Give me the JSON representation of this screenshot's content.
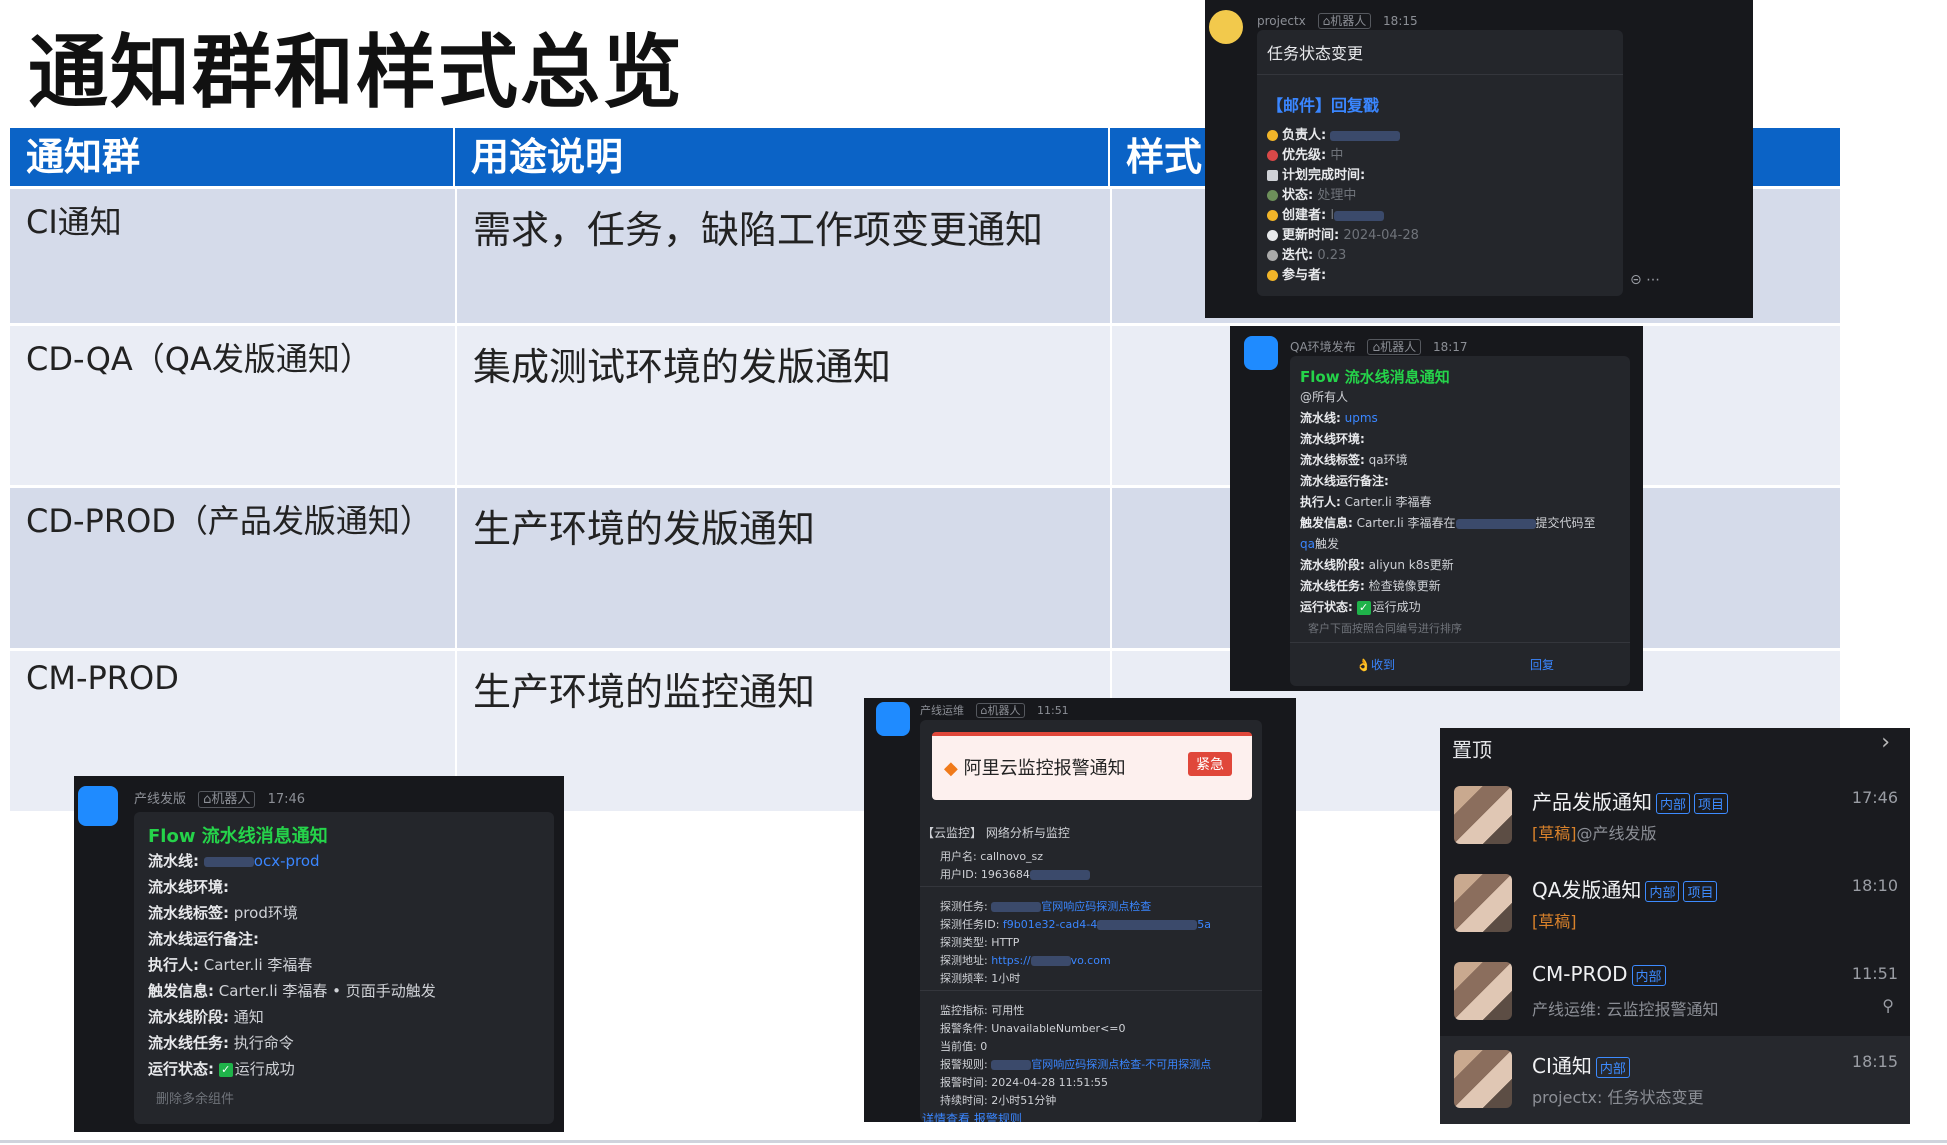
{
  "title": "通知群和样式总览",
  "table": {
    "headers": [
      "通知群",
      "用途说明",
      "样式"
    ],
    "rows": [
      {
        "group": "CI通知",
        "purpose": "需求，任务，缺陷工作项变更通知"
      },
      {
        "group": "CD-QA（QA发版通知）",
        "purpose": "集成测试环境的发版通知"
      },
      {
        "group": "CD-PROD（产品发版通知）",
        "purpose": "生产环境的发版通知"
      },
      {
        "group": "CM-PROD",
        "purpose": "生产环境的监控通知"
      }
    ]
  },
  "card_ci": {
    "sender": "projectx",
    "robot": "机器人",
    "time": "18:15",
    "header": "任务状态变更",
    "title": "【邮件】回复戳",
    "fields": [
      {
        "label": "负责人:",
        "value": ""
      },
      {
        "label": "优先级:",
        "value": "中"
      },
      {
        "label": "计划完成时间:",
        "value": ""
      },
      {
        "label": "状态:",
        "value": "处理中"
      },
      {
        "label": "创建者:",
        "value": "I"
      },
      {
        "label": "更新时间:",
        "value": "2024-04-28"
      },
      {
        "label": "迭代:",
        "value": "0.23"
      },
      {
        "label": "参与者:",
        "value": ""
      }
    ]
  },
  "card_qa": {
    "sender": "QA环境发布",
    "robot": "机器人",
    "time": "18:17",
    "title": "Flow 流水线消息通知",
    "mention": "@所有人",
    "fields": [
      {
        "label": "流水线:",
        "value": "upms"
      },
      {
        "label": "流水线环境:",
        "value": ""
      },
      {
        "label": "流水线标签:",
        "value": "qa环境"
      },
      {
        "label": "流水线运行备注:",
        "value": ""
      },
      {
        "label": "执行人:",
        "value": "Carter.li 李福春"
      },
      {
        "label": "触发信息:",
        "value": "Carter.li 李福春在"
      },
      {
        "label": "流水线阶段:",
        "value": "aliyun k8s更新"
      },
      {
        "label": "流水线任务:",
        "value": "检查镜像更新"
      },
      {
        "label": "运行状态:",
        "value": "运行成功"
      }
    ],
    "trigger_tail": "提交代码至",
    "trigger_line2a": "qa",
    "trigger_line2b": "触发",
    "note": "客户下面按照合同编号进行排序",
    "btn_received": "收到",
    "btn_reply": "回复"
  },
  "card_prod": {
    "sender": "产线发版",
    "robot": "机器人",
    "time": "17:46",
    "title": "Flow 流水线消息通知",
    "fields": [
      {
        "label": "流水线:",
        "value": "ocx-prod"
      },
      {
        "label": "流水线环境:",
        "value": ""
      },
      {
        "label": "流水线标签:",
        "value": "prod环境"
      },
      {
        "label": "流水线运行备注:",
        "value": ""
      },
      {
        "label": "执行人:",
        "value": "Carter.li 李福春"
      },
      {
        "label": "触发信息:",
        "value": "Carter.li 李福春 • 页面手动触发"
      },
      {
        "label": "流水线阶段:",
        "value": "通知"
      },
      {
        "label": "流水线任务:",
        "value": "执行命令"
      },
      {
        "label": "运行状态:",
        "value": "运行成功"
      }
    ],
    "footer": "删除多余组件"
  },
  "card_cm": {
    "sender": "产线运维",
    "robot": "机器人",
    "time": "11:51",
    "banner": "阿里云监控报警通知",
    "urgent": "紧急",
    "section": "【云监控】 网络分析与监控",
    "user_lines": [
      "用户名: callnovo_sz",
      "用户ID: 1963684"
    ],
    "probe_lines": [
      {
        "label": "探测任务: ",
        "blue": "官网响应码探测点检查"
      },
      {
        "label": "探测任务ID: ",
        "blue": "f9b01e32-cad4-4",
        "tail": "5a"
      },
      {
        "label": "探测类型: HTTP",
        "blue": ""
      },
      {
        "label": "探测地址: ",
        "blue": "https://",
        "tail": "vo.com"
      },
      {
        "label": "探测频率: 1小时",
        "blue": ""
      }
    ],
    "alarm_lines": [
      {
        "label": "监控指标: 可用性",
        "blue": ""
      },
      {
        "label": "报警条件: UnavailableNumber<=0",
        "blue": ""
      },
      {
        "label": "当前值: 0",
        "blue": ""
      },
      {
        "label": "报警规则: ",
        "blue": "官网响应码探测点检查-不可用探测点"
      },
      {
        "label": "报警时间: 2024-04-28 11:51:55",
        "blue": ""
      },
      {
        "label": "持续时间: 2小时51分钟",
        "blue": ""
      }
    ],
    "links": "详情查看 报警规则"
  },
  "pinned": {
    "header": "置顶",
    "items": [
      {
        "name": "产品发版通知",
        "badges": [
          "内部",
          "项目"
        ],
        "sub_tag": "[草稿]",
        "sub": "@产线发版",
        "time": "17:46"
      },
      {
        "name": "QA发版通知",
        "badges": [
          "内部",
          "项目"
        ],
        "sub_tag": "[草稿]",
        "sub": "",
        "time": "18:10"
      },
      {
        "name": "CM-PROD",
        "badges": [
          "内部"
        ],
        "sub_tag": "",
        "sub": "产线运维: 云监控报警通知",
        "time": "11:51"
      },
      {
        "name": "CI通知",
        "badges": [
          "内部"
        ],
        "sub_tag": "",
        "sub": "projectx: 任务状态变更",
        "time": "18:15"
      }
    ]
  }
}
